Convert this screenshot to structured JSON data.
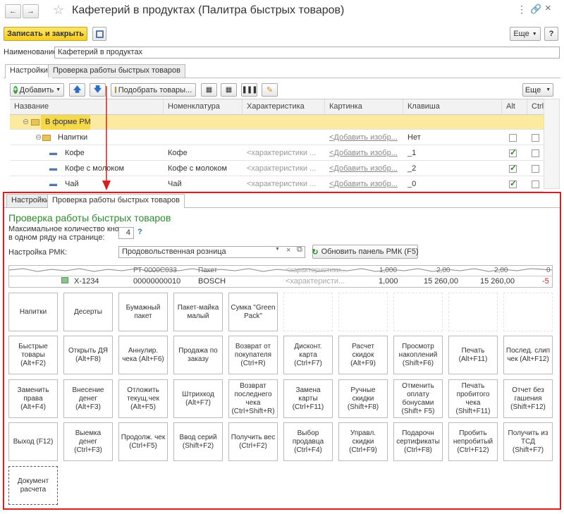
{
  "window": {
    "title": "Кафетерий в продуктах (Палитра быстрых товаров)"
  },
  "toolbar": {
    "save_close": "Записать и закрыть",
    "more": "Еще"
  },
  "name_field": {
    "label": "Наименование:",
    "value": "Кафетерий в продуктах"
  },
  "tabs": [
    "Настройки",
    "Проверка работы быстрых товаров"
  ],
  "grid_toolbar": {
    "add": "Добавить",
    "pick": "Подобрать товары...",
    "more": "Еще"
  },
  "grid": {
    "columns": [
      "Название",
      "Номенклатура",
      "Характеристика",
      "Картинка",
      "Клавиша",
      "Alt",
      "Ctrl"
    ],
    "rows": [
      {
        "name": "В форме РМК",
        "nomen": "",
        "char": "",
        "pic": "",
        "key": "",
        "alt": false,
        "ctrl": false
      },
      {
        "name": "Напитки",
        "nomen": "",
        "char": "",
        "pic": "<Добавить изобр...",
        "key": "Нет",
        "alt": false,
        "ctrl": false
      },
      {
        "name": "Кофе",
        "nomen": "Кофе",
        "char": "<характеристики ...",
        "pic": "<Добавить изобр...",
        "key": "_1",
        "alt": true,
        "ctrl": false
      },
      {
        "name": "Кофе с молоком",
        "nomen": "Кофе с молоком",
        "char": "<характеристики ...",
        "pic": "<Добавить изобр...",
        "key": "_2",
        "alt": true,
        "ctrl": false
      },
      {
        "name": "Чай",
        "nomen": "Чай",
        "char": "<характеристики ...",
        "pic": "<Добавить изобр...",
        "key": "_0",
        "alt": true,
        "ctrl": false
      }
    ]
  },
  "preview": {
    "tabs": [
      "Настройки",
      "Проверка работы быстрых товаров"
    ],
    "heading": "Проверка работы быстрых товаров",
    "max_buttons": {
      "label_line1": "Максимальное количество кнопок",
      "label_line2": "в одном ряду на странице:",
      "value": "4",
      "help": "?"
    },
    "rmk": {
      "label": "Настройка РМК:",
      "value": "Продовольственная розница",
      "refresh": "Обновить панель РМК (F5)"
    },
    "torn_row": {
      "article": "РТ-0000С033",
      "nomen": "Пакет",
      "char": "<характеристики...",
      "qty": "1,000",
      "price": "2,00",
      "sum": "2,00",
      "disc": "0"
    },
    "check_row": {
      "article": "X-1234",
      "nomen": "00000000010",
      "char": "BOSCH",
      "char2": "<характеристи...",
      "qty": "1,000",
      "price": "15 260,00",
      "sum": "15 260,00",
      "disc": "-5"
    },
    "goods_buttons": [
      "Напитки",
      "Десерты",
      "Бумажный пакет",
      "Пакет-майка малый",
      "Сумка \"Green Pack\""
    ],
    "function_buttons": [
      [
        "Быстрые товары (Alt+F2)",
        "Открыть ДЯ (Alt+F8)",
        "Аннулир. чека (Alt+F6)",
        "Продажа по заказу",
        "Возврат от покупателя (Ctrl+R)",
        "Дисконт. карта (Ctrl+F7)",
        "Расчет скидок (Alt+F9)",
        "Просмотр накоплений (Shift+F6)",
        "Печать (Alt+F11)",
        "Послед. слип чек (Alt+F12)"
      ],
      [
        "Заменить права (Alt+F4)",
        "Внесение денег (Alt+F3)",
        "Отложить текущ.чек (Alt+F5)",
        "Штрихкод (Alt+F7)",
        "Возврат последнего чека (Ctrl+Shift+R)",
        "Замена карты (Ctrl+F11)",
        "Ручные скидки (Shift+F8)",
        "Отменить оплату бонусами (Shift+ F5)",
        "Печать пробитого чека (Shift+F11)",
        "Отчет без гашения (Shift+F12)"
      ],
      [
        "Выход (F12)",
        "Выемка денег (Ctrl+F3)",
        "Продолж. чек (Ctrl+F5)",
        "Ввод серий (Shift+F2)",
        "Получить вес (Ctrl+F2)",
        "Выбор продавца (Ctrl+F4)",
        "Управл. скидки (Ctrl+F9)",
        "Подарочн сертификаты (Ctrl+F8)",
        "Пробить непробитый (Ctrl+F12)",
        "Получить из ТСД (Shift+F7)"
      ],
      [
        "Документ расчета"
      ]
    ]
  },
  "colors": {
    "accent_green": "#2e8b2e",
    "highlight": "#fbeaa0",
    "frame_red": "#d81e1e",
    "save_yellow": "#f6cd1c"
  }
}
